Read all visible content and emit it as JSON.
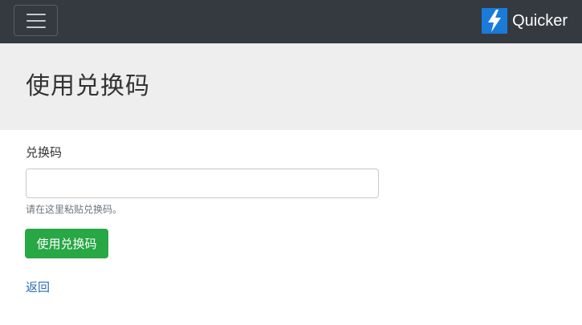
{
  "navbar": {
    "brand_name": "Quicker",
    "toggler_icon": "hamburger-menu-icon",
    "logo_icon": "lightning-bolt-icon",
    "background_color": "#343a40"
  },
  "header": {
    "title": "使用兑换码",
    "background_color": "#eeeeee"
  },
  "form": {
    "code_label": "兑换码",
    "code_value": "",
    "code_placeholder": "",
    "help_text": "请在这里粘贴兑换码。",
    "submit_label": "使用兑换码",
    "submit_color": "#28a745",
    "back_label": "返回",
    "link_color": "#2a6db5"
  }
}
